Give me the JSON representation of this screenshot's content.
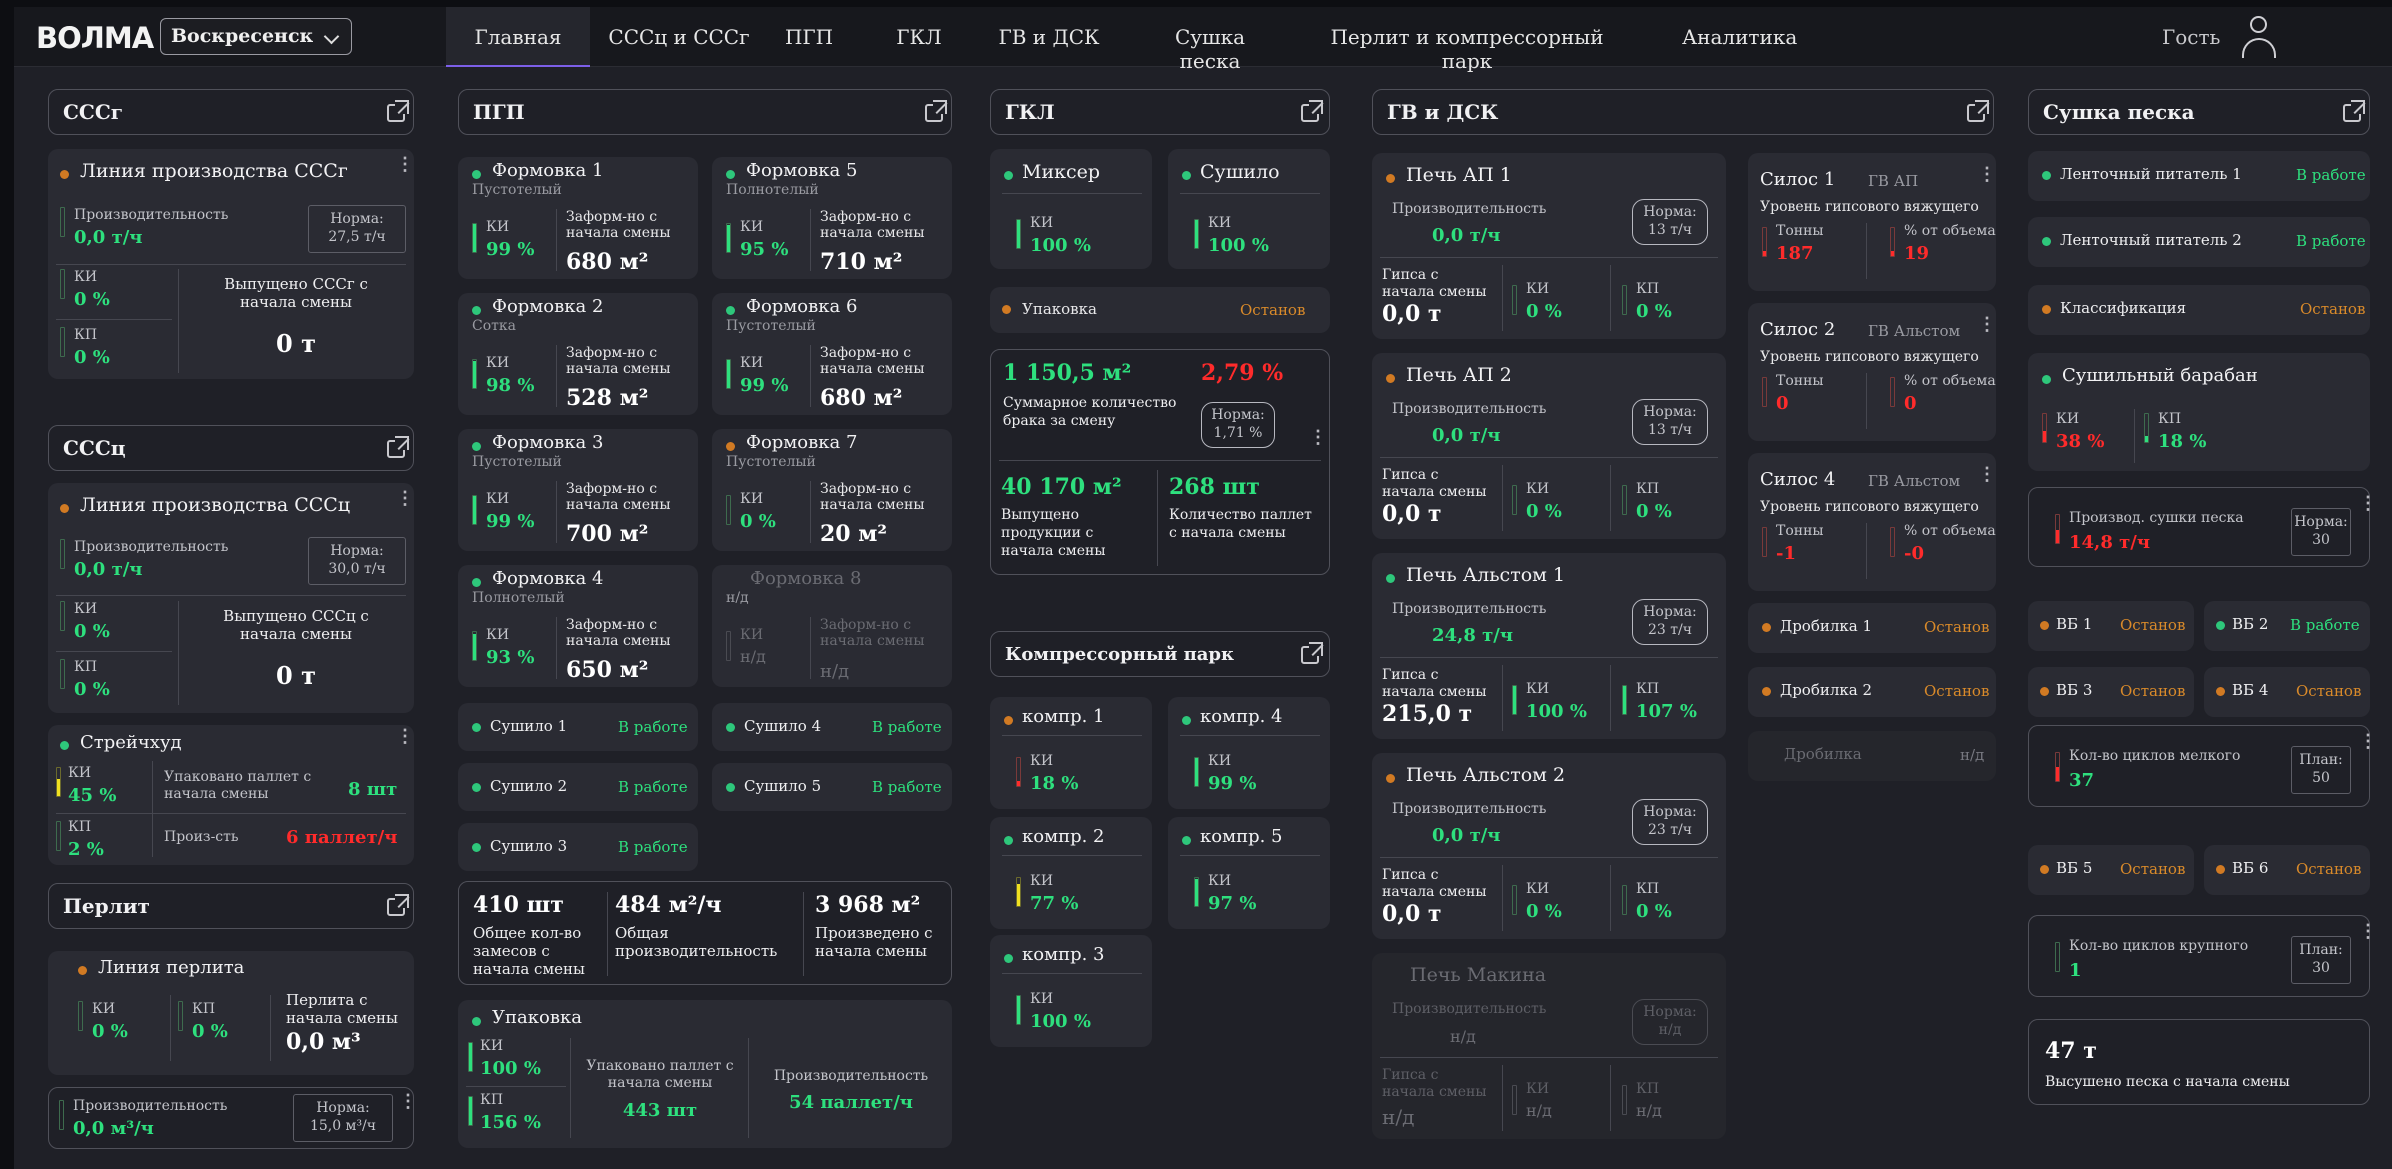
{
  "header": {
    "logo": "ВОЛМА",
    "city": "Воскресенск",
    "nav": [
      "Главная",
      "СССц и СССг",
      "ПГП",
      "ГКЛ",
      "ГВ и ДСК",
      "Сушка песка",
      "Перлит и компрессорный парк",
      "Аналитика"
    ],
    "user": "Гость"
  },
  "common": {
    "ki": "КИ",
    "kp": "КП",
    "perf": "Производительность",
    "norm": "Норма:",
    "plan": "План:",
    "running": "В работе",
    "stopped": "Останов",
    "na": "н/д",
    "formed": "Заформ-но с начала смены",
    "gypsum": "Гипса с начала смены",
    "level": "Уровень гипсового вяжущего",
    "tons": "Тонны",
    "pct_vol": "% от объема"
  },
  "sssg": {
    "title": "СССг",
    "line": "Линия производства СССг",
    "perf": "0,0 т/ч",
    "norm": "27,5 т/ч",
    "ki": "0 %",
    "kp": "0 %",
    "released_label": "Выпущено СССг с начала смены",
    "released": "0 т"
  },
  "sssc": {
    "title": "СССц",
    "line": "Линия производства СССц",
    "perf": "0,0 т/ч",
    "norm": "30,0 т/ч",
    "ki": "0 %",
    "kp": "0 %",
    "released_label": "Выпущено СССц с начала смены",
    "released": "0 т"
  },
  "streych": {
    "title": "Стрейчхуд",
    "ki": "45 %",
    "kp": "2 %",
    "packed_label": "Упаковано паллет с начала смены",
    "packed": "8 шт",
    "perf_label": "Произ-сть",
    "perf": "6 паллет/ч"
  },
  "perlit": {
    "title": "Перлит",
    "line": "Линия перлита",
    "ki": "0 %",
    "kp": "0 %",
    "since_label": "Перлита с начала смены",
    "since": "0,0 м³",
    "perf": "0,0 м³/ч",
    "norm": "15,0 м³/ч"
  },
  "pgp": {
    "title": "ПГП",
    "forms": [
      {
        "name": "Формовка 1",
        "type": "Пустотелый",
        "ki": "99 %",
        "val": "680 м²"
      },
      {
        "name": "Формовка 5",
        "type": "Полнотелый",
        "ki": "95 %",
        "val": "710 м²"
      },
      {
        "name": "Формовка 2",
        "type": "Сотка",
        "ki": "98 %",
        "val": "528 м²"
      },
      {
        "name": "Формовка 6",
        "type": "Пустотелый",
        "ki": "99 %",
        "val": "680 м²"
      },
      {
        "name": "Формовка 3",
        "type": "Пустотелый",
        "ki": "99 %",
        "val": "700 м²"
      },
      {
        "name": "Формовка 7",
        "type": "Пустотелый",
        "ki": "0 %",
        "val": "20 м²"
      },
      {
        "name": "Формовка 4",
        "type": "Полнотелый",
        "ki": "93 %",
        "val": "650 м²"
      },
      {
        "name": "Формовка 8",
        "type": "н/д",
        "ki": "н/д",
        "val": "н/д"
      }
    ],
    "dryers": [
      "Сушило 1",
      "Сушило 4",
      "Сушило 2",
      "Сушило 5",
      "Сушило 3"
    ],
    "total_batches": "410 шт",
    "total_batches_label": "Общее кол-во замесов с начала смены",
    "total_perf": "484 м²/ч",
    "total_perf_label": "Общая производительность",
    "produced": "3 968 м²",
    "produced_label": "Произведено с начала смены",
    "pack": {
      "title": "Упаковка",
      "ki": "100 %",
      "kp": "156 %",
      "packed_label": "Упаковано паллет с начала смены",
      "packed": "443 шт",
      "perf_label": "Производительность",
      "perf": "54 паллет/ч"
    }
  },
  "gkl": {
    "title": "ГКЛ",
    "mixer": {
      "name": "Миксер",
      "ki": "100 %"
    },
    "dryer": {
      "name": "Сушило",
      "ki": "100 %"
    },
    "pack": "Упаковка",
    "area": "1 150,5 м²",
    "defect": "2,79 %",
    "defect_label": "Суммарное количество брака за смену",
    "defect_norm": "1,71 %",
    "released": "40 170 м²",
    "released_label": "Выпущено продукции с начала смены",
    "pallets": "268 шт",
    "pallets_label": "Количество паллет с начала смены"
  },
  "compr": {
    "title": "Компрессорный парк",
    "items": [
      {
        "name": "компр. 1",
        "ki": "18 %"
      },
      {
        "name": "компр. 4",
        "ki": "99 %"
      },
      {
        "name": "компр. 2",
        "ki": "77 %"
      },
      {
        "name": "компр. 5",
        "ki": "97 %"
      },
      {
        "name": "компр. 3",
        "ki": "100 %"
      }
    ]
  },
  "gv": {
    "title": "ГВ и ДСК",
    "ovens": [
      {
        "name": "Печь АП 1",
        "perf": "0,0 т/ч",
        "norm": "13 т/ч",
        "gyps": "0,0 т",
        "ki": "0 %",
        "kp": "0 %"
      },
      {
        "name": "Печь АП 2",
        "perf": "0,0 т/ч",
        "norm": "13 т/ч",
        "gyps": "0,0 т",
        "ki": "0 %",
        "kp": "0 %"
      },
      {
        "name": "Печь Альстом 1",
        "perf": "24,8 т/ч",
        "norm": "23 т/ч",
        "gyps": "215,0 т",
        "ki": "100 %",
        "kp": "107 %"
      },
      {
        "name": "Печь Альстом 2",
        "perf": "0,0 т/ч",
        "norm": "23 т/ч",
        "gyps": "0,0 т",
        "ki": "0 %",
        "kp": "0 %"
      },
      {
        "name": "Печь Макина",
        "perf": "н/д",
        "norm": "н/д",
        "gyps": "н/д",
        "ki": "н/д",
        "kp": "н/д"
      }
    ],
    "silos": [
      {
        "name": "Силос 1",
        "src": "ГВ АП",
        "tons": "187",
        "pct": "19"
      },
      {
        "name": "Силос 2",
        "src": "ГВ Альстом",
        "tons": "0",
        "pct": "0"
      },
      {
        "name": "Силос 4",
        "src": "ГВ Альстом",
        "tons": "-1",
        "pct": "-0"
      }
    ],
    "crushers": [
      "Дробилка 1",
      "Дробилка 2",
      "Дробилка"
    ]
  },
  "sand": {
    "title": "Сушка песка",
    "items": [
      "Ленточный питатель 1",
      "Ленточный питатель 2",
      "Классификация"
    ],
    "drum": {
      "title": "Сушильный барабан",
      "ki": "38 %",
      "kp": "18 %"
    },
    "dry_perf_label": "Производ. сушки песка",
    "dry_perf": "14,8 т/ч",
    "dry_norm": "30",
    "vb": [
      "ВБ 1",
      "ВБ 2",
      "ВБ 3",
      "ВБ 4",
      "ВБ 5",
      "ВБ 6"
    ],
    "small_label": "Кол-во циклов мелкого",
    "small": "37",
    "small_plan": "50",
    "large_label": "Кол-во циклов крупного",
    "large": "1",
    "large_plan": "30",
    "dried": "47 т",
    "dried_label": "Высушено песка с начала смены"
  }
}
